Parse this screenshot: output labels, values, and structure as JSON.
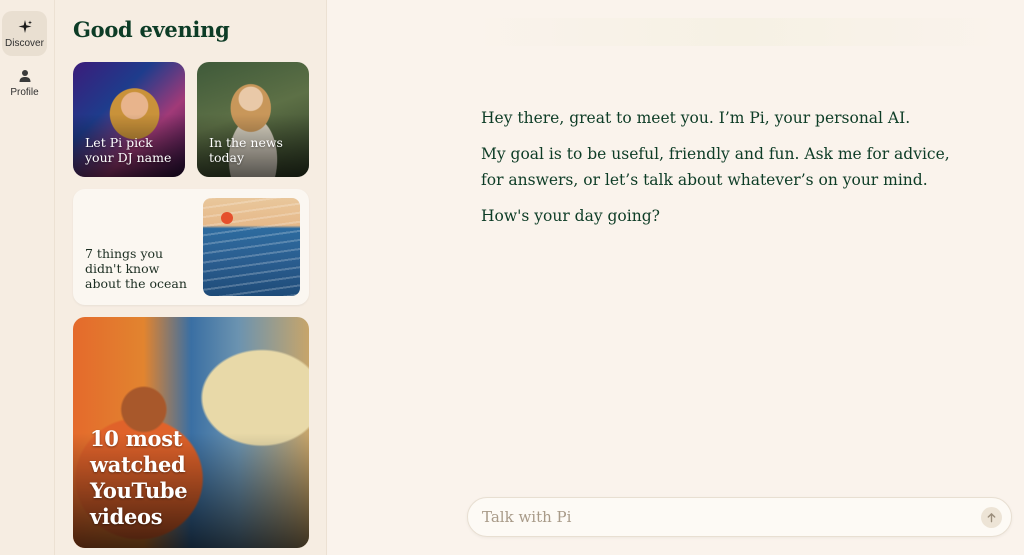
{
  "nav": {
    "items": [
      {
        "label": "Discover",
        "icon": "sparkle-icon",
        "active": true
      },
      {
        "label": "Profile",
        "icon": "person-icon",
        "active": false
      }
    ]
  },
  "discover": {
    "greeting": "Good evening",
    "cards": [
      {
        "caption": "Let Pi pick your DJ name"
      },
      {
        "caption": "In the news today"
      },
      {
        "caption": "7 things you didn't know about the ocean"
      },
      {
        "caption": "10 most watched YouTube videos"
      }
    ]
  },
  "chat": {
    "messages": [
      "Hey there, great to meet you. I’m Pi, your personal AI.",
      "My goal is to be useful, friendly and fun. Ask me for advice, for answers, or let’s talk about whatever’s on your mind.",
      "How's your day going?"
    ],
    "composer": {
      "placeholder": "Talk with Pi",
      "value": ""
    }
  },
  "colors": {
    "text": "#0d3c26",
    "background": "#faf3ec",
    "sidebar": "#f6ede2"
  }
}
